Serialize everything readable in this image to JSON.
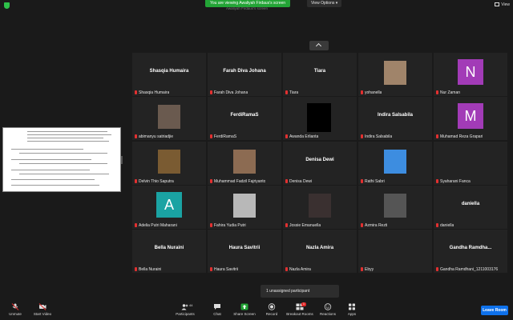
{
  "top": {
    "banner": "You are viewing Awaliyah Firdaus's screen",
    "view_options": "View Options",
    "subtitle": "Awaliyah Firdaus's screen",
    "view": "View"
  },
  "tiles": [
    {
      "name": "Shasqia Humaira",
      "label": "Shasqia Humaira",
      "kind": "name"
    },
    {
      "name": "Farah Diva Johana",
      "label": "Farah Diva Johana",
      "kind": "name"
    },
    {
      "name": "Tiara",
      "label": "Tiara",
      "kind": "name"
    },
    {
      "name": "",
      "label": "yohanella",
      "kind": "photo",
      "photo": "#a0846a"
    },
    {
      "name": "",
      "label": "Nur Zaman",
      "kind": "letter",
      "letter": "N",
      "color": "#a23bb7"
    },
    {
      "name": "",
      "label": "abimanyu satriadjie",
      "kind": "photo",
      "photo": "#6a5a4f"
    },
    {
      "name": "FerdiRamaS",
      "label": "FerdiRamaS",
      "kind": "name"
    },
    {
      "name": "",
      "label": "Awanda Erlianta",
      "kind": "black"
    },
    {
      "name": "Indira Salsabila",
      "label": "Indira Salsabila",
      "kind": "name"
    },
    {
      "name": "",
      "label": "Muhamad Reza Grapari",
      "kind": "letter",
      "letter": "M",
      "color": "#a23bb7"
    },
    {
      "name": "",
      "label": "Delvin Thio Saputra",
      "kind": "photo",
      "photo": "#7a5b32"
    },
    {
      "name": "",
      "label": "Muhammad Fadzil Fajriyanto",
      "kind": "photo",
      "photo": "#8c6b52"
    },
    {
      "name": "Denisa Dewi",
      "label": "Denisa Dewi",
      "kind": "name"
    },
    {
      "name": "",
      "label": "Rathi Sabri",
      "kind": "photo",
      "photo": "#3d8de0"
    },
    {
      "name": "",
      "label": "Syaharani Fanca",
      "kind": "name"
    },
    {
      "name": "",
      "label": "Adelia Putri Maharani",
      "kind": "letter",
      "letter": "A",
      "color": "#1aa3a3"
    },
    {
      "name": "",
      "label": "Fahira Yudia Putri",
      "kind": "photo",
      "photo": "#b8b8b8"
    },
    {
      "name": "",
      "label": "Jossie Emanuella",
      "kind": "photo",
      "photo": "#3a3030"
    },
    {
      "name": "",
      "label": "Azmira Rezti",
      "kind": "photo",
      "photo": "#555"
    },
    {
      "name": "daniella",
      "label": "daniella",
      "kind": "name"
    },
    {
      "name": "Bella Nuraini",
      "label": "Bella Nuraini",
      "kind": "name"
    },
    {
      "name": "Haura Savitrii",
      "label": "Haura Savitrii",
      "kind": "name"
    },
    {
      "name": "Nazla Amira",
      "label": "Nazla Amira",
      "kind": "name"
    },
    {
      "name": "",
      "label": "Ebyy",
      "kind": "name"
    },
    {
      "name": "Gandha  Ramdha...",
      "label": "Gandha Ramdhani_1211003176",
      "kind": "name"
    }
  ],
  "unassigned": "1 unassigned participant",
  "toolbar": {
    "unmute": "Unmute",
    "start_video": "Start Video",
    "participants": "Participants",
    "participants_count": "44",
    "chat": "Chat",
    "share_screen": "Share Screen",
    "record": "Record",
    "breakout_rooms": "Breakout Rooms",
    "breakout_badge": "1",
    "reactions": "Reactions",
    "apps": "Apps",
    "leave": "Leave Room"
  },
  "colors": {
    "accent_green": "#23a436",
    "leave_blue": "#0e71eb",
    "mic_red": "#e23030"
  }
}
